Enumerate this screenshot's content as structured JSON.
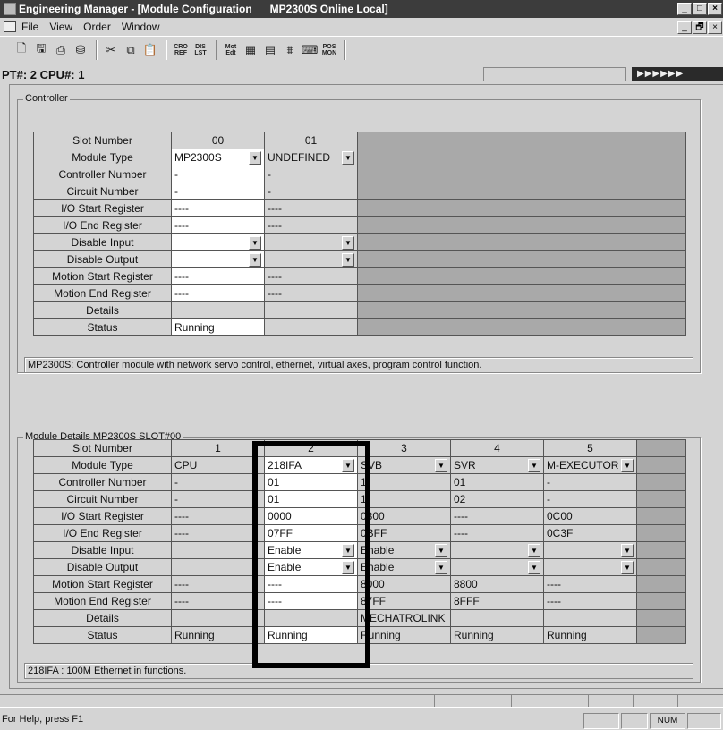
{
  "window": {
    "title_app": "Engineering Manager - [Module Configuration",
    "title_ctx": "MP2300S  Online Local]",
    "btn_min": "_",
    "btn_max": "□",
    "btn_close": "×",
    "btn_restore": "🗗"
  },
  "menu": {
    "items": [
      "File",
      "View",
      "Order",
      "Window"
    ]
  },
  "toolbar": {
    "icons": [
      "new-file-icon",
      "save-icon",
      "print-icon",
      "connect-icon",
      "cut-icon",
      "copy-icon",
      "paste-icon"
    ],
    "small_labels": [
      "CRO\nREF",
      "DIS\nLST",
      "Mot\nEdt",
      "",
      "",
      "",
      "",
      "POS\nMON"
    ]
  },
  "pt_bar": {
    "label": "PT#: 2 CPU#: 1",
    "run_indicator": "▶▶▶▶▶▶"
  },
  "controller": {
    "group_label": "Controller",
    "row_labels": [
      "Slot Number",
      "Module Type",
      "Controller Number",
      "Circuit Number",
      "I/O Start Register",
      "I/O End Register",
      "Disable Input",
      "Disable Output",
      "Motion Start Register",
      "Motion End Register",
      "Details",
      "Status"
    ],
    "slots": [
      "00",
      "01"
    ],
    "col00": [
      "MP2300S",
      "-",
      "-",
      "----",
      "----",
      "",
      "",
      "----",
      "----",
      "",
      "Running"
    ],
    "col01": [
      "UNDEFINED",
      "-",
      "-",
      "----",
      "----",
      "",
      "",
      "----",
      "----",
      "",
      ""
    ],
    "description": "MP2300S: Controller module with network servo control, ethernet, virtual axes, program control function."
  },
  "module_details": {
    "group_label": "Module Details  MP2300S  SLOT#00",
    "slots": [
      "1",
      "2",
      "3",
      "4",
      "5"
    ],
    "col1": [
      "CPU",
      "-",
      "-",
      "----",
      "----",
      "",
      "",
      "----",
      "----",
      "",
      "Running"
    ],
    "col2": [
      "218IFA",
      "01",
      "01",
      "0000",
      "07FF",
      "Enable",
      "Enable",
      "----",
      "----",
      "",
      "Running"
    ],
    "col3": [
      "SVB",
      "1",
      "1",
      "0800",
      "0BFF",
      "Enable",
      "Enable",
      "8000",
      "87FF",
      "MECHATROLINK",
      "Running"
    ],
    "col4": [
      "SVR",
      "01",
      "02",
      "----",
      "----",
      "",
      "",
      "8800",
      "8FFF",
      "",
      "Running"
    ],
    "col5": [
      "M-EXECUTOR",
      "-",
      "-",
      "0C00",
      "0C3F",
      "",
      "",
      "----",
      "----",
      "",
      "Running"
    ],
    "description": "218IFA : 100M Ethernet in functions."
  },
  "statusbar": {
    "help": "For Help, press F1",
    "num": "NUM"
  }
}
